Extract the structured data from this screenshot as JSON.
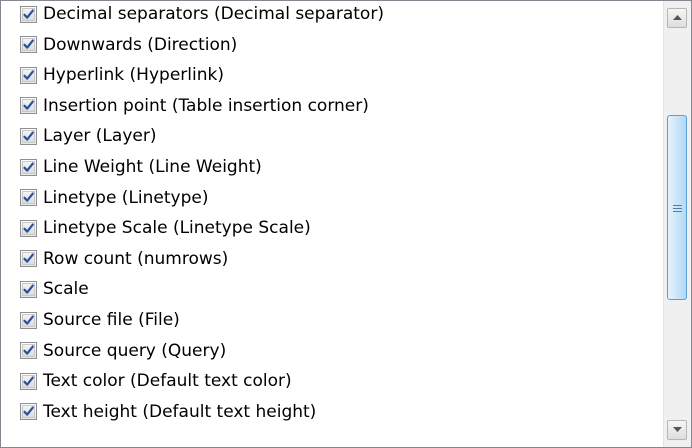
{
  "list": {
    "items": [
      {
        "label": "Decimal separators (Decimal separator)",
        "checked": true
      },
      {
        "label": "Downwards (Direction)",
        "checked": true
      },
      {
        "label": "Hyperlink (Hyperlink)",
        "checked": true
      },
      {
        "label": "Insertion point (Table insertion corner)",
        "checked": true
      },
      {
        "label": "Layer (Layer)",
        "checked": true
      },
      {
        "label": "Line Weight (Line Weight)",
        "checked": true
      },
      {
        "label": "Linetype (Linetype)",
        "checked": true
      },
      {
        "label": "Linetype Scale (Linetype Scale)",
        "checked": true
      },
      {
        "label": "Row count (numrows)",
        "checked": true
      },
      {
        "label": "Scale",
        "checked": true
      },
      {
        "label": "Source file (File)",
        "checked": true
      },
      {
        "label": "Source query (Query)",
        "checked": true
      },
      {
        "label": "Text color (Default text color)",
        "checked": true
      },
      {
        "label": "Text height (Default text height)",
        "checked": true
      }
    ]
  },
  "scrollbar": {
    "position_fraction": 0.42,
    "visible_fraction": 0.55,
    "up_icon": "arrow-up-icon",
    "down_icon": "arrow-down-icon",
    "grip_icon": "grip-icon"
  },
  "colors": {
    "check_mark": "#2a4f9e",
    "thumb_border": "#5f9ed1"
  }
}
